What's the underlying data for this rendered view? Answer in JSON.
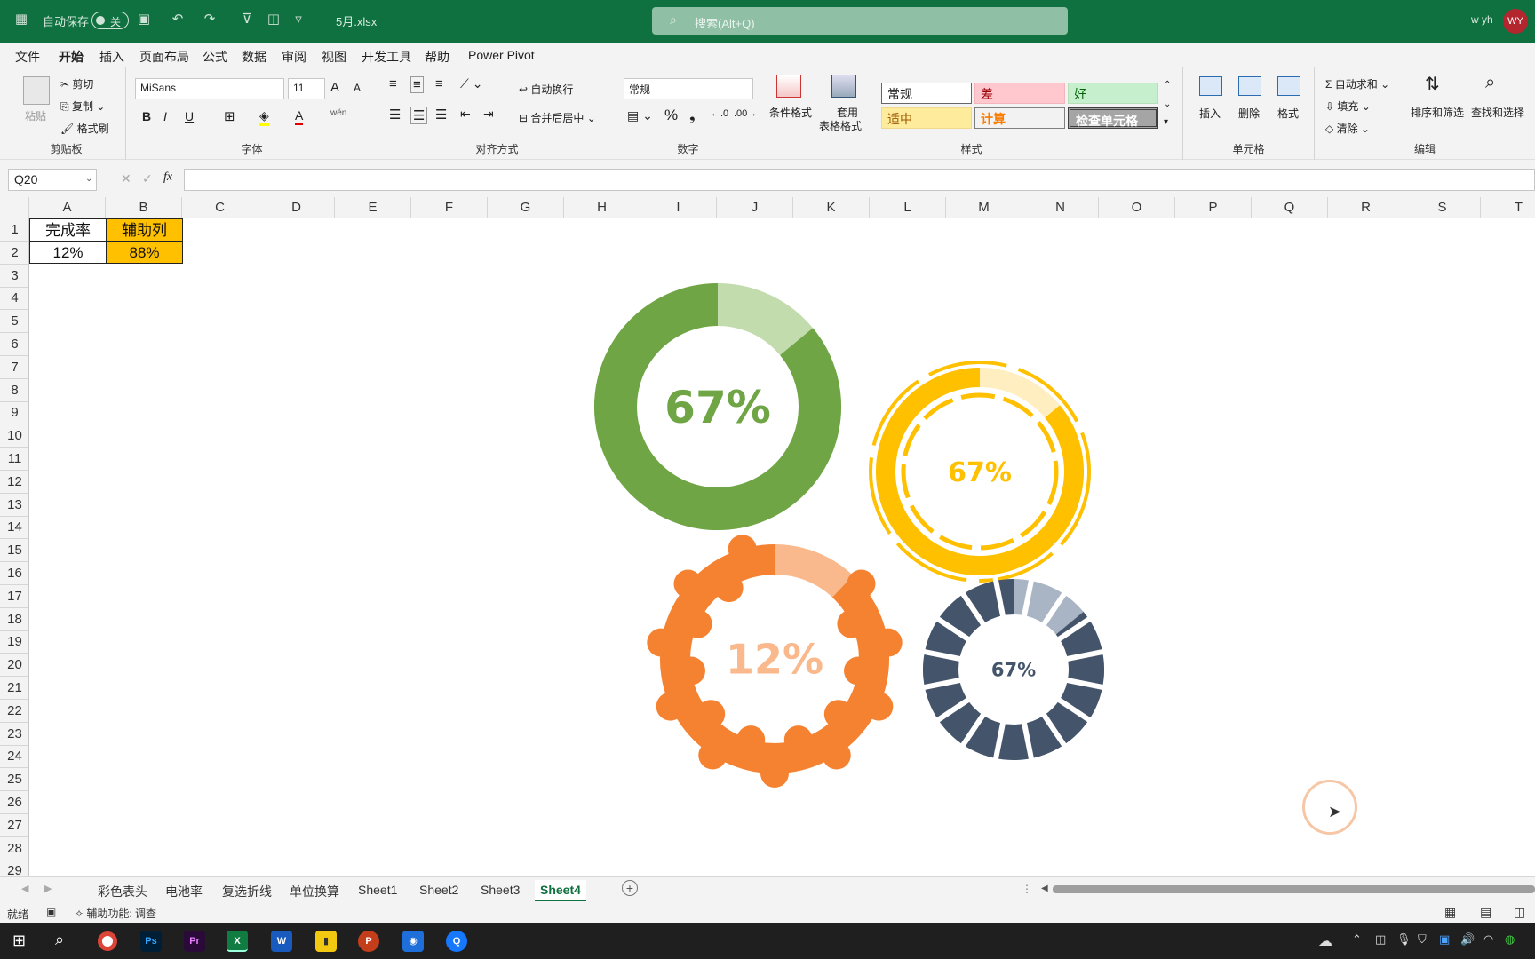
{
  "titlebar": {
    "autosave_label": "自动保存",
    "autosave_state": "关",
    "filename": "5月.xlsx",
    "search_placeholder": "搜索(Alt+Q)",
    "user_name": "w yh",
    "user_initials": "WY"
  },
  "menu": [
    "文件",
    "开始",
    "插入",
    "页面布局",
    "公式",
    "数据",
    "审阅",
    "视图",
    "开发工具",
    "帮助",
    "Power Pivot"
  ],
  "menu_active": "开始",
  "ribbon": {
    "clipboard": {
      "label": "剪贴板",
      "paste": "粘贴",
      "cut": "剪切",
      "copy": "复制",
      "format_painter": "格式刷"
    },
    "font": {
      "label": "字体",
      "name": "MiSans",
      "size": "11",
      "bold": "B",
      "italic": "I",
      "underline": "U",
      "wen": "wén",
      "grow": "A",
      "shrink": "A"
    },
    "alignment": {
      "label": "对齐方式",
      "wrap": "自动换行",
      "merge": "合并后居中"
    },
    "number": {
      "label": "数字",
      "format": "常规",
      "percent": "%",
      "comma": "❟"
    },
    "styles": {
      "label": "样式",
      "conditional": "条件格式",
      "table_line1": "套用",
      "table_line2": "表格格式",
      "cells": [
        "常规",
        "差",
        "好",
        "适中",
        "计算",
        "检查单元格"
      ]
    },
    "cells": {
      "label": "单元格",
      "insert": "插入",
      "delete": "删除",
      "format": "格式"
    },
    "editing": {
      "label": "编辑",
      "autosum": "自动求和",
      "fill": "填充",
      "clear": "清除",
      "sort": "排序和筛选",
      "find": "查找和选择"
    }
  },
  "formula": {
    "namebox": "Q20",
    "fx": "fx",
    "value": ""
  },
  "columns": [
    "A",
    "B",
    "C",
    "D",
    "E",
    "F",
    "G",
    "H",
    "I",
    "J",
    "K",
    "L",
    "M",
    "N",
    "O",
    "P",
    "Q",
    "R",
    "S",
    "T"
  ],
  "rows": [
    "1",
    "2",
    "3",
    "4",
    "5",
    "6",
    "7",
    "8",
    "9",
    "10",
    "11",
    "12",
    "13",
    "14",
    "15",
    "16",
    "17",
    "18",
    "19",
    "20",
    "21",
    "22",
    "23",
    "24",
    "25",
    "26",
    "27",
    "28",
    "29"
  ],
  "cells": {
    "A1": "完成率",
    "B1": "辅助列",
    "A2": "12%",
    "B2": "88%"
  },
  "charts": [
    {
      "label": "67%",
      "value": 0.67,
      "color": "#6fa544",
      "track": "#c3dcae",
      "style": "solid-ring"
    },
    {
      "label": "67%",
      "value": 0.67,
      "color": "#ffc000",
      "track": "#ffeebf",
      "style": "double-ring"
    },
    {
      "label": "12%",
      "value": 0.12,
      "color": "#f58231",
      "track": "#f9b98c",
      "style": "bumpy-ring"
    },
    {
      "label": "67%",
      "value": 0.67,
      "color": "#44546a",
      "track": "#a9b4c4",
      "style": "gear-ring"
    }
  ],
  "sheet_tabs": [
    "彩色表头",
    "电池率",
    "复选折线",
    "单位换算",
    "Sheet1",
    "Sheet2",
    "Sheet3",
    "Sheet4"
  ],
  "active_sheet": "Sheet4",
  "status": {
    "ready": "就绪",
    "accessibility": "辅助功能: 调查"
  }
}
